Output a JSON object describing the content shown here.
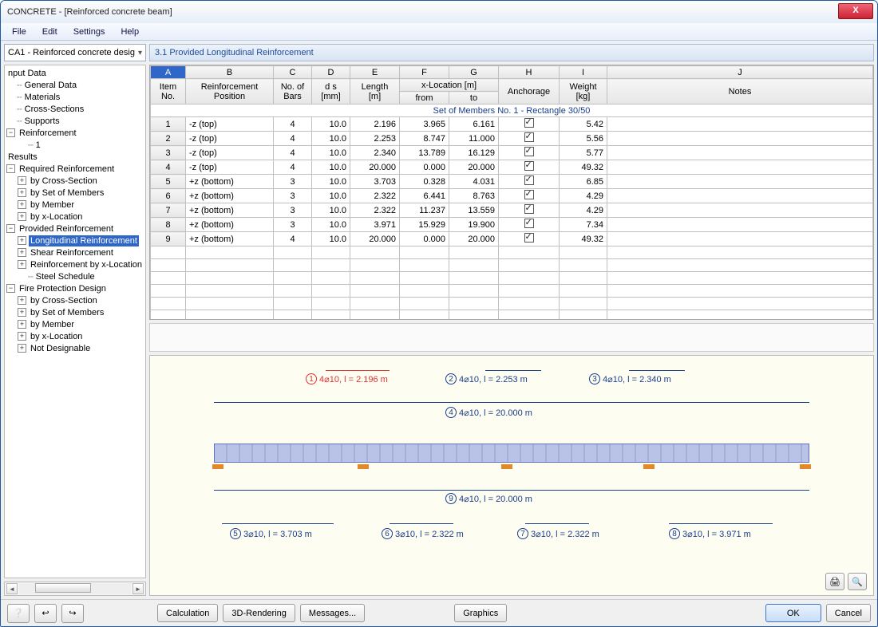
{
  "window": {
    "title": "CONCRETE - [Reinforced concrete beam]",
    "close_icon": "X"
  },
  "menu": {
    "file": "File",
    "edit": "Edit",
    "settings": "Settings",
    "help": "Help"
  },
  "case_dropdown": {
    "value": "CA1 - Reinforced concrete desig"
  },
  "tree": {
    "n0": "nput Data",
    "n1": "General Data",
    "n2": "Materials",
    "n3": "Cross-Sections",
    "n4": "Supports",
    "n5": "Reinforcement",
    "n6": "1",
    "n7": "Results",
    "n8": "Required Reinforcement",
    "n9": "by Cross-Section",
    "n10": "by Set of Members",
    "n11": "by Member",
    "n12": "by x-Location",
    "n13": "Provided Reinforcement",
    "n14": "Longitudinal Reinforcement",
    "n15": "Shear Reinforcement",
    "n16": "Reinforcement by x-Location",
    "n17": "Steel Schedule",
    "n18": "Fire Protection Design",
    "n19": "by Cross-Section",
    "n20": "by Set of Members",
    "n21": "by Member",
    "n22": "by x-Location",
    "n23": "Not Designable"
  },
  "section": {
    "title": "3.1 Provided Longitudinal Reinforcement"
  },
  "table": {
    "cols": {
      "A": "A",
      "B": "B",
      "C": "C",
      "D": "D",
      "E": "E",
      "F": "F",
      "G": "G",
      "H": "H",
      "I": "I",
      "J": "J"
    },
    "hdr": {
      "item": "Item",
      "item2": "No.",
      "reinf": "Reinforcement",
      "reinf2": "Position",
      "no_of": "No. of",
      "bars": "Bars",
      "ds": "d s",
      "mm": "[mm]",
      "len": "Length",
      "m": "[m]",
      "xloc": "x-Location [m]",
      "from": "from",
      "to": "to",
      "anch": "Anchorage",
      "weight": "Weight",
      "kg": "[kg]",
      "notes": "Notes"
    },
    "group": "Set of Members No. 1  -  Rectangle 30/50",
    "rows": [
      {
        "n": "1",
        "pos": "-z (top)",
        "bars": "4",
        "ds": "10.0",
        "len": "2.196",
        "from": "3.965",
        "to": "6.161",
        "anch": true,
        "w": "5.42"
      },
      {
        "n": "2",
        "pos": "-z (top)",
        "bars": "4",
        "ds": "10.0",
        "len": "2.253",
        "from": "8.747",
        "to": "11.000",
        "anch": true,
        "w": "5.56"
      },
      {
        "n": "3",
        "pos": "-z (top)",
        "bars": "4",
        "ds": "10.0",
        "len": "2.340",
        "from": "13.789",
        "to": "16.129",
        "anch": true,
        "w": "5.77"
      },
      {
        "n": "4",
        "pos": "-z (top)",
        "bars": "4",
        "ds": "10.0",
        "len": "20.000",
        "from": "0.000",
        "to": "20.000",
        "anch": true,
        "w": "49.32"
      },
      {
        "n": "5",
        "pos": "+z (bottom)",
        "bars": "3",
        "ds": "10.0",
        "len": "3.703",
        "from": "0.328",
        "to": "4.031",
        "anch": true,
        "w": "6.85"
      },
      {
        "n": "6",
        "pos": "+z (bottom)",
        "bars": "3",
        "ds": "10.0",
        "len": "2.322",
        "from": "6.441",
        "to": "8.763",
        "anch": true,
        "w": "4.29"
      },
      {
        "n": "7",
        "pos": "+z (bottom)",
        "bars": "3",
        "ds": "10.0",
        "len": "2.322",
        "from": "11.237",
        "to": "13.559",
        "anch": true,
        "w": "4.29"
      },
      {
        "n": "8",
        "pos": "+z (bottom)",
        "bars": "3",
        "ds": "10.0",
        "len": "3.971",
        "from": "15.929",
        "to": "19.900",
        "anch": true,
        "w": "7.34"
      },
      {
        "n": "9",
        "pos": "+z (bottom)",
        "bars": "4",
        "ds": "10.0",
        "len": "20.000",
        "from": "0.000",
        "to": "20.000",
        "anch": true,
        "w": "49.32"
      }
    ]
  },
  "diagram": {
    "l1": "4⌀10, l = 2.196 m",
    "l2": "4⌀10, l = 2.253 m",
    "l3": "4⌀10, l = 2.340 m",
    "l4": "4⌀10, l = 20.000 m",
    "l5": "3⌀10, l = 3.703 m",
    "l6": "3⌀10, l = 2.322 m",
    "l7": "3⌀10, l = 2.322 m",
    "l8": "3⌀10, l = 3.971 m",
    "l9": "4⌀10, l = 20.000 m",
    "n1": "1",
    "n2": "2",
    "n3": "3",
    "n4": "4",
    "n5": "5",
    "n6": "6",
    "n7": "7",
    "n8": "8",
    "n9": "9"
  },
  "footer": {
    "calc": "Calculation",
    "render": "3D-Rendering",
    "msgs": "Messages...",
    "gfx": "Graphics",
    "ok": "OK",
    "cancel": "Cancel"
  }
}
